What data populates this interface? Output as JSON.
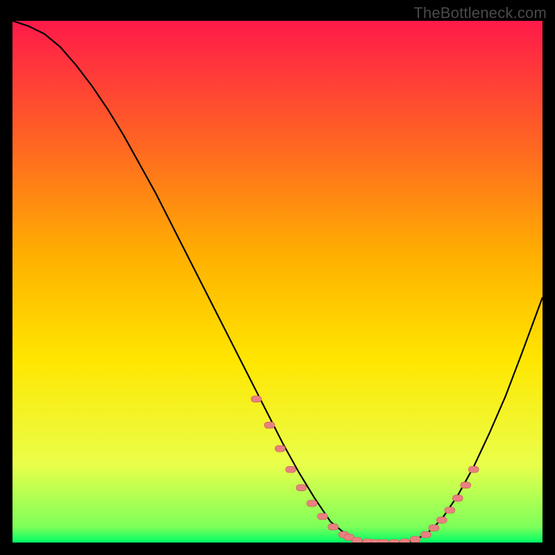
{
  "watermark": "TheBottleneck.com",
  "colors": {
    "background": "#000000",
    "gradient_top": "#ff1a4a",
    "gradient_mid1": "#ff5a2a",
    "gradient_mid2": "#ffb000",
    "gradient_mid3": "#ffe600",
    "gradient_mid4": "#eaff4a",
    "gradient_bottom": "#00ff66",
    "curve": "#000000",
    "marker_fill": "#e98080",
    "marker_stroke": "#c45858"
  },
  "chart_data": {
    "type": "line",
    "title": "",
    "xlabel": "",
    "ylabel": "",
    "xlim": [
      0,
      100
    ],
    "ylim": [
      0,
      100
    ],
    "series": [
      {
        "name": "bottleneck-curve",
        "x": [
          0,
          3,
          6,
          9,
          12,
          15,
          18,
          21,
          24,
          27,
          30,
          33,
          36,
          39,
          42,
          45,
          48,
          51,
          54,
          57,
          60,
          63,
          66,
          69,
          72,
          75,
          78,
          81,
          84,
          87,
          90,
          93,
          96,
          100
        ],
        "y": [
          100,
          99,
          97.5,
          95,
          91.5,
          87.5,
          83,
          78,
          72.5,
          67,
          61,
          55,
          49,
          43,
          37,
          31,
          25,
          19,
          13.5,
          8.5,
          4,
          1.5,
          0.3,
          0,
          0,
          0.2,
          1.5,
          4.5,
          9,
          14.5,
          21,
          28,
          36,
          47
        ]
      }
    ],
    "markers": {
      "name": "highlight-points",
      "x": [
        46,
        48.5,
        50.5,
        52.5,
        54.5,
        56.5,
        58.5,
        60.5,
        62.5,
        63.5,
        65,
        67,
        68.5,
        70,
        72,
        74,
        76,
        78,
        79.5,
        81,
        82.5,
        84,
        85.5,
        87
      ],
      "y": [
        27.5,
        22.5,
        18,
        14,
        10.5,
        7.5,
        5,
        3,
        1.5,
        1,
        0.4,
        0.1,
        0,
        0,
        0,
        0.1,
        0.6,
        1.5,
        2.8,
        4.3,
        6.2,
        8.5,
        11,
        14
      ]
    }
  }
}
